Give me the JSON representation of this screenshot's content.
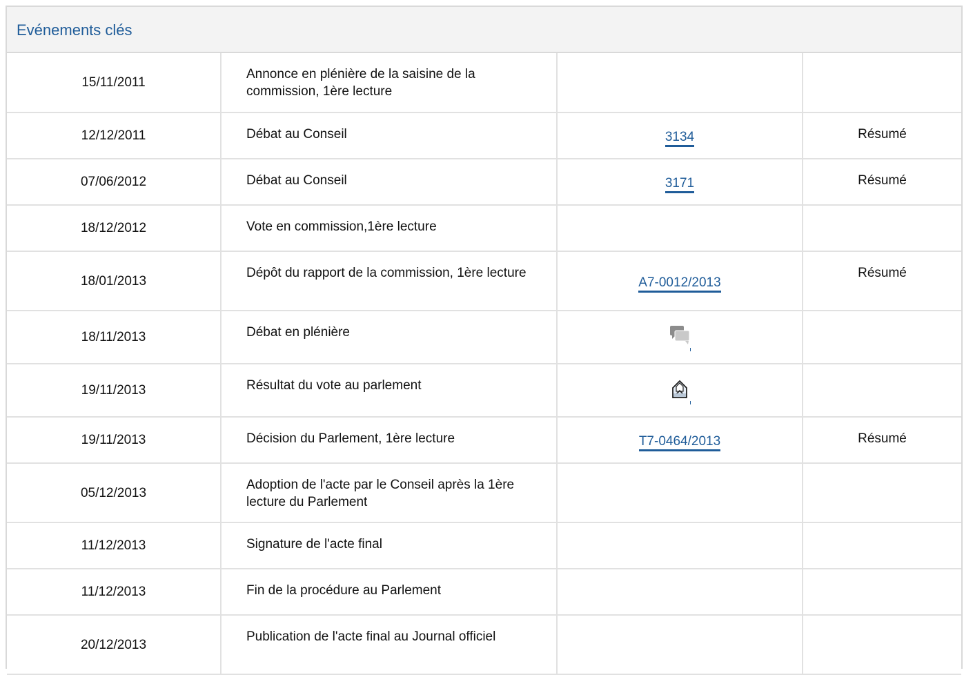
{
  "section": {
    "title": "Evénements clés"
  },
  "events": [
    {
      "date": "15/11/2011",
      "title": "Annonce en plénière de la saisine de la commission, 1ère lecture",
      "ref": "",
      "summary": ""
    },
    {
      "date": "12/12/2011",
      "title": "Débat au Conseil",
      "ref": "3134",
      "summary": "Résumé"
    },
    {
      "date": "07/06/2012",
      "title": "Débat au Conseil",
      "ref": "3171",
      "summary": "Résumé"
    },
    {
      "date": "18/12/2012",
      "title": "Vote en commission,1ère lecture",
      "ref": "",
      "summary": ""
    },
    {
      "date": "18/01/2013",
      "title": "Dépôt du rapport de la commission, 1ère lecture",
      "ref": "A7-0012/2013",
      "summary": "Résumé"
    },
    {
      "date": "18/11/2013",
      "title": "Débat en plénière",
      "ref_icon": "debate-speech-bubbles-icon",
      "summary": ""
    },
    {
      "date": "19/11/2013",
      "title": "Résultat du vote au parlement",
      "ref_icon": "ballot-box-vote-icon",
      "summary": ""
    },
    {
      "date": "19/11/2013",
      "title": "Décision du Parlement, 1ère lecture",
      "ref": "T7-0464/2013",
      "summary": "Résumé"
    },
    {
      "date": "05/12/2013",
      "title": "Adoption de l'acte par le Conseil après la 1ère lecture du Parlement",
      "ref": "",
      "summary": ""
    },
    {
      "date": "11/12/2013",
      "title": "Signature de l'acte final",
      "ref": "",
      "summary": ""
    },
    {
      "date": "11/12/2013",
      "title": "Fin de la procédure au Parlement",
      "ref": "",
      "summary": ""
    },
    {
      "date": "20/12/2013",
      "title": "Publication de l'acte final au Journal officiel",
      "ref": "",
      "summary": ""
    }
  ],
  "colors": {
    "link": "#1f5c99",
    "header_bg": "#f3f3f3",
    "border": "#e1e1e1"
  }
}
